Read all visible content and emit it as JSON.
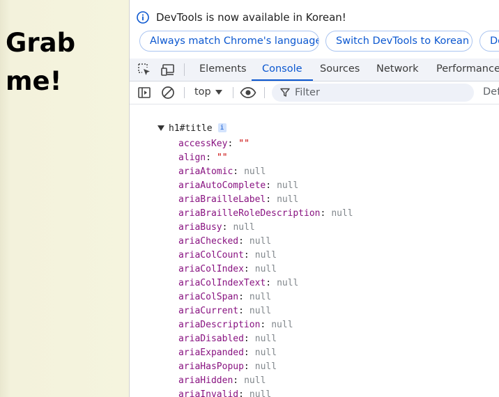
{
  "page": {
    "heading": "Grab me!"
  },
  "infobar": {
    "icon": "info-icon",
    "message": "DevTools is now available in Korean!",
    "buttons": [
      "Always match Chrome's language",
      "Switch DevTools to Korean",
      "Don't show again"
    ]
  },
  "tabbar": {
    "icons": [
      "inspect-element-icon",
      "device-toolbar-icon"
    ],
    "tabs": [
      "Elements",
      "Console",
      "Sources",
      "Network",
      "Performance"
    ],
    "active_tab": "Console"
  },
  "toolbar": {
    "icons": [
      "sidebar-toggle-icon",
      "clear-console-icon",
      "eye-icon",
      "filter-icon"
    ],
    "context": "top",
    "filter_placeholder": "Filter",
    "levels": "Default levels"
  },
  "console": {
    "object_label": "h1#title",
    "info_badge": "i",
    "properties": [
      {
        "name": "accessKey",
        "value": "\"\"",
        "kind": "string"
      },
      {
        "name": "align",
        "value": "\"\"",
        "kind": "string"
      },
      {
        "name": "ariaAtomic",
        "value": "null",
        "kind": "null"
      },
      {
        "name": "ariaAutoComplete",
        "value": "null",
        "kind": "null"
      },
      {
        "name": "ariaBrailleLabel",
        "value": "null",
        "kind": "null"
      },
      {
        "name": "ariaBrailleRoleDescription",
        "value": "null",
        "kind": "null"
      },
      {
        "name": "ariaBusy",
        "value": "null",
        "kind": "null"
      },
      {
        "name": "ariaChecked",
        "value": "null",
        "kind": "null"
      },
      {
        "name": "ariaColCount",
        "value": "null",
        "kind": "null"
      },
      {
        "name": "ariaColIndex",
        "value": "null",
        "kind": "null"
      },
      {
        "name": "ariaColIndexText",
        "value": "null",
        "kind": "null"
      },
      {
        "name": "ariaColSpan",
        "value": "null",
        "kind": "null"
      },
      {
        "name": "ariaCurrent",
        "value": "null",
        "kind": "null"
      },
      {
        "name": "ariaDescription",
        "value": "null",
        "kind": "null"
      },
      {
        "name": "ariaDisabled",
        "value": "null",
        "kind": "null"
      },
      {
        "name": "ariaExpanded",
        "value": "null",
        "kind": "null"
      },
      {
        "name": "ariaHasPopup",
        "value": "null",
        "kind": "null"
      },
      {
        "name": "ariaHidden",
        "value": "null",
        "kind": "null"
      },
      {
        "name": "ariaInvalid",
        "value": "null",
        "kind": "null"
      }
    ]
  },
  "colors": {
    "accent": "#0b57d0",
    "property_name": "#881280",
    "string_value": "#c80000",
    "null_value": "#80868b"
  }
}
